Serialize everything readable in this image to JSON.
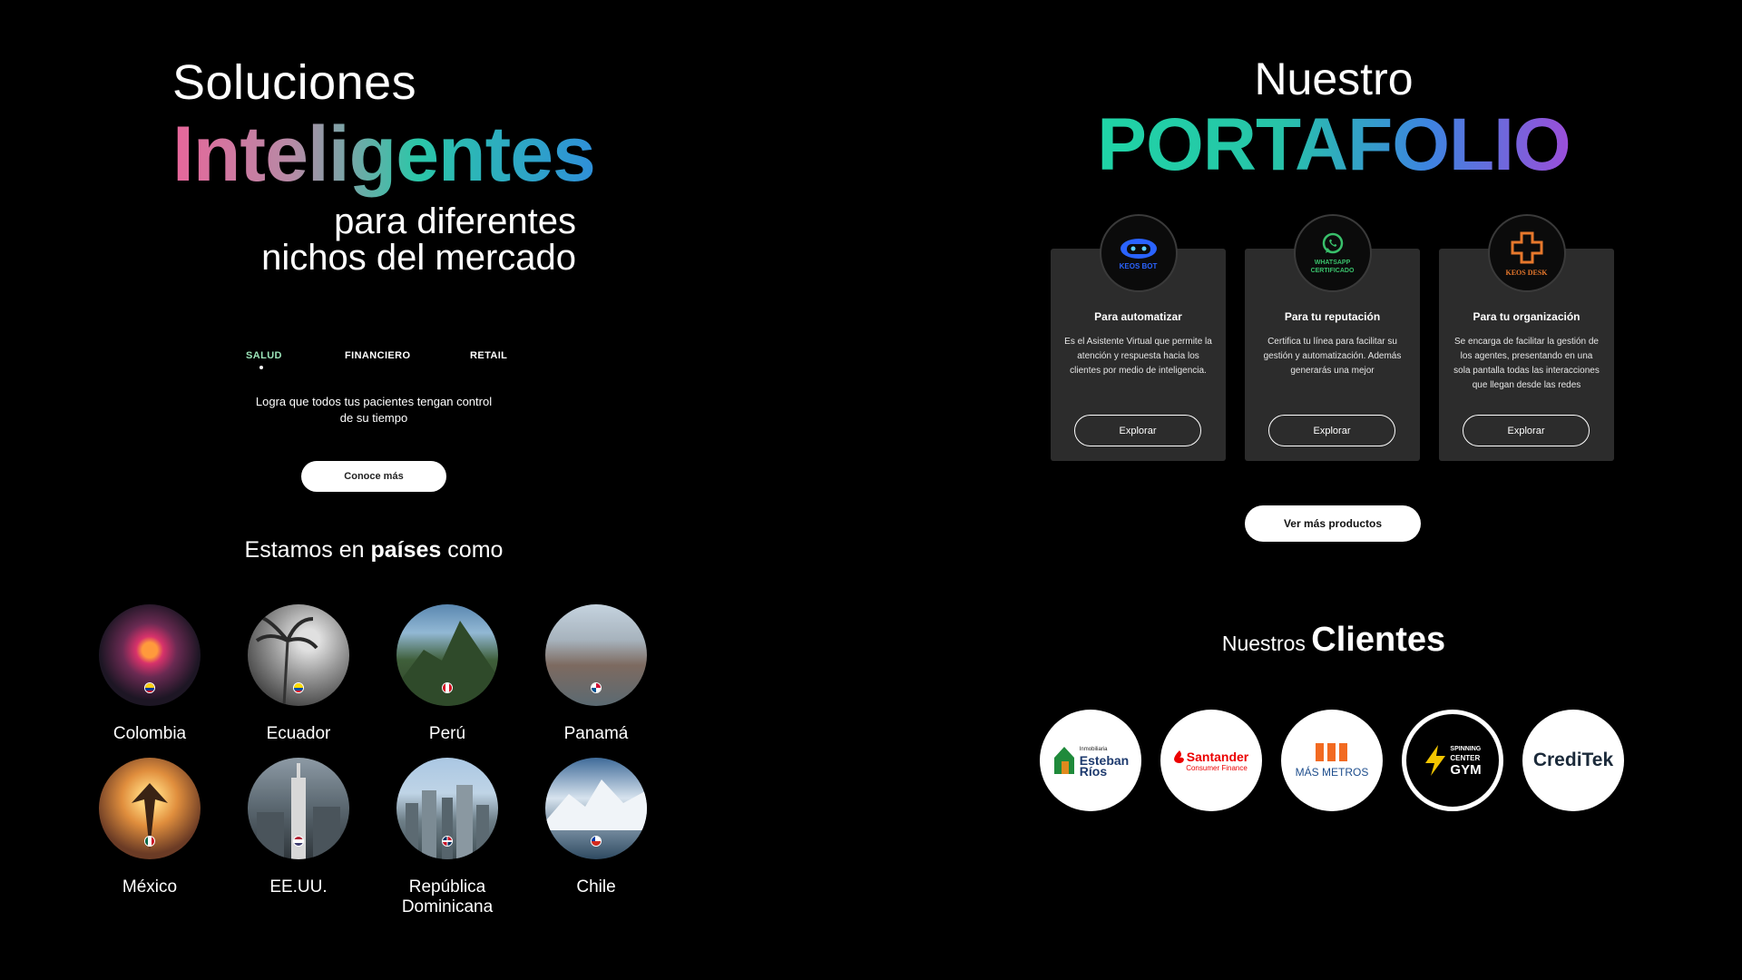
{
  "hero": {
    "line1": "Soluciones",
    "line2": "Inteligentes",
    "line3": "para diferentes",
    "line4": "nichos del mercado"
  },
  "sectors": {
    "tabs": [
      {
        "label": "SALUD",
        "active": true
      },
      {
        "label": "FINANCIERO",
        "active": false
      },
      {
        "label": "RETAIL",
        "active": false
      }
    ],
    "description": "Logra que todos tus pacientes tengan control de su tiempo",
    "button": "Conoce más"
  },
  "countries": {
    "title_start": "Estamos en ",
    "title_bold": "países",
    "title_end": " como",
    "items": [
      {
        "name": "Colombia"
      },
      {
        "name": "Ecuador"
      },
      {
        "name": "Perú"
      },
      {
        "name": "Panamá"
      },
      {
        "name": "México"
      },
      {
        "name": "EE.UU."
      },
      {
        "name": "República Dominicana"
      },
      {
        "name": "Chile"
      }
    ]
  },
  "portfolio": {
    "title1": "Nuestro",
    "title2": "PORTAFOLIO",
    "cards": [
      {
        "logo_text": "KEOS BOT",
        "title": "Para automatizar",
        "description": "Es el Asistente Virtual que permite la atención y respuesta hacia los clientes por medio de inteligencia.",
        "button": "Explorar"
      },
      {
        "logo_text": "WHATSAPP CERTIFICADO",
        "title": "Para tu reputación",
        "description": "Certifica tu línea para facilitar su gestión y automatización. Además generarás una mejor",
        "button": "Explorar"
      },
      {
        "logo_text": "KEOS DESK",
        "title": "Para tu organización",
        "description": "Se encarga de facilitar la gestión de los agentes, presentando en una sola pantalla todas las interacciones que llegan desde las redes",
        "button": "Explorar"
      }
    ],
    "more_button": "Ver más productos"
  },
  "clients": {
    "title_light": "Nuestros ",
    "title_bold": "Clientes",
    "logos": [
      {
        "line1": "Inmobiliaria",
        "line2": "Esteban",
        "line3": "Ríos"
      },
      {
        "line1": "Santander",
        "line2": "Consumer Finance"
      },
      {
        "line1": "MÁS METROS"
      },
      {
        "line1": "SPINNING",
        "line2": "CENTER",
        "line3": "GYM"
      },
      {
        "line1": "CrediTek"
      }
    ]
  },
  "colors": {
    "background": "#000000",
    "card": "#2c2c2c",
    "active_tab": "#9be3b8",
    "santander_red": "#ec0000",
    "masmetros_orange": "#f26a21",
    "gym_yellow": "#f2c500",
    "keosbot_blue": "#2a63ff",
    "keosdesk_orange": "#e7782c",
    "whatsapp_green": "#39c06b"
  }
}
